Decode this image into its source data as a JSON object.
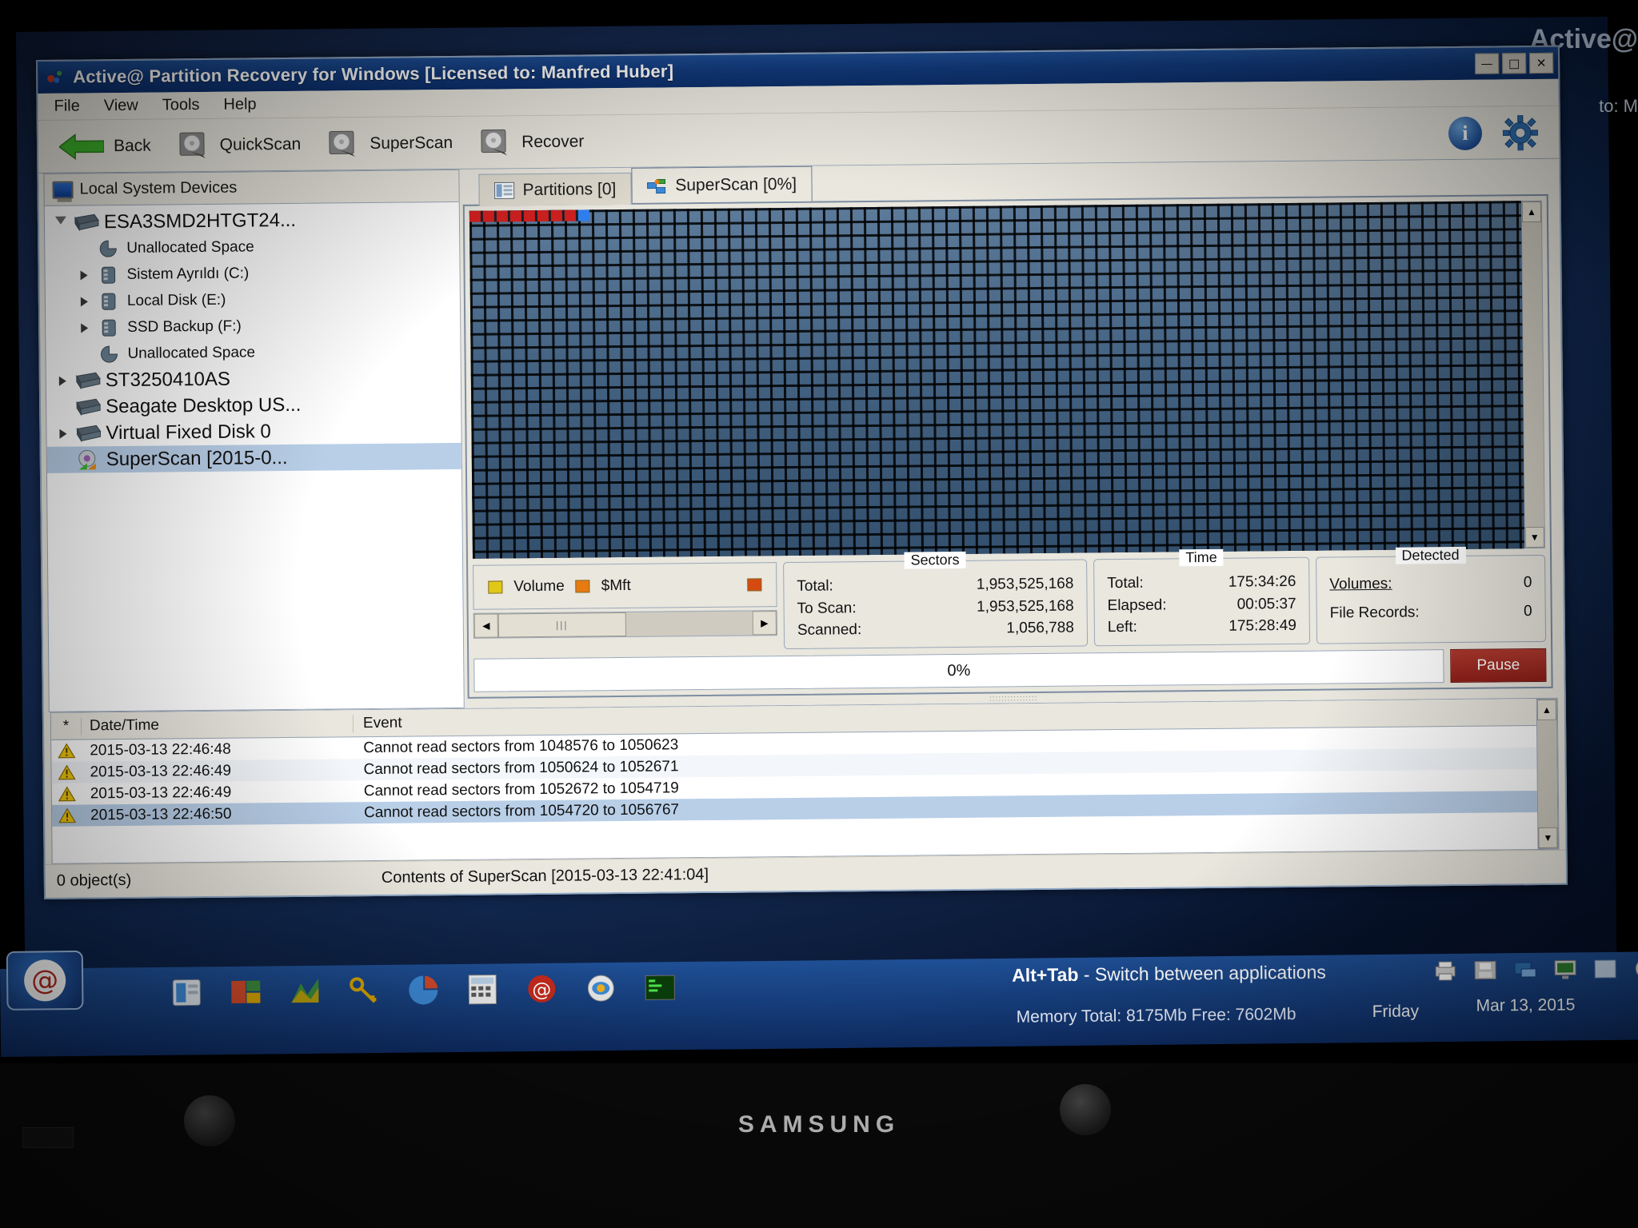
{
  "window": {
    "title": "Active@ Partition Recovery for Windows [Licensed to: Manfred Huber]",
    "minimize": "—",
    "maximize": "□",
    "close": "✕"
  },
  "menu": {
    "items": [
      "File",
      "View",
      "Tools",
      "Help"
    ]
  },
  "toolbar": {
    "back": "Back",
    "quickscan": "QuickScan",
    "superscan": "SuperScan",
    "recover": "Recover",
    "info": "i"
  },
  "sidebar": {
    "header": "Local System Devices",
    "items": [
      {
        "label": "ESA3SMD2HTGT24...",
        "level": 0,
        "icon": "disk-icon",
        "twisty": "open",
        "size": "big"
      },
      {
        "label": "Unallocated Space",
        "level": 1,
        "icon": "pie-icon",
        "twisty": "none",
        "size": "small"
      },
      {
        "label": "Sistem Ayrıldı (C:)",
        "level": 1,
        "icon": "volume-icon",
        "twisty": "closed",
        "size": "small"
      },
      {
        "label": "Local Disk (E:)",
        "level": 1,
        "icon": "volume-icon",
        "twisty": "closed",
        "size": "small"
      },
      {
        "label": "SSD Backup (F:)",
        "level": 1,
        "icon": "volume-icon",
        "twisty": "closed",
        "size": "small"
      },
      {
        "label": "Unallocated Space",
        "level": 1,
        "icon": "pie-icon",
        "twisty": "none",
        "size": "small"
      },
      {
        "label": "ST3250410AS",
        "level": 0,
        "icon": "disk-icon",
        "twisty": "closed",
        "size": "big"
      },
      {
        "label": "Seagate Desktop US...",
        "level": 0,
        "icon": "disk-icon",
        "twisty": "none",
        "size": "big"
      },
      {
        "label": "Virtual Fixed Disk 0",
        "level": 0,
        "icon": "disk-icon",
        "twisty": "closed",
        "size": "big"
      },
      {
        "label": "SuperScan [2015-0...",
        "level": 0,
        "icon": "superscan-icon",
        "twisty": "none",
        "size": "big",
        "selected": true
      }
    ]
  },
  "tabs": [
    {
      "label": "Partitions [0]",
      "icon": "partitions-icon",
      "active": false
    },
    {
      "label": "SuperScan [0%]",
      "icon": "superscan-tab-icon",
      "active": true
    }
  ],
  "legend": {
    "volume_label": "Volume",
    "volume_color": "#e0c818",
    "mft_label": "$Mft",
    "mft_color": "#e87a12",
    "third_color": "#d64a10"
  },
  "sectors": {
    "caption": "Sectors",
    "rows": [
      {
        "key": "Total:",
        "value": "1,953,525,168"
      },
      {
        "key": "To Scan:",
        "value": "1,953,525,168"
      },
      {
        "key": "Scanned:",
        "value": "1,056,788"
      }
    ]
  },
  "time": {
    "caption": "Time",
    "rows": [
      {
        "key": "Total:",
        "value": "175:34:26"
      },
      {
        "key": "Elapsed:",
        "value": "00:05:37"
      },
      {
        "key": "Left:",
        "value": "175:28:49"
      }
    ]
  },
  "detected": {
    "caption": "Detected",
    "rows": [
      {
        "key": "Volumes:",
        "value": "0",
        "underline": true
      },
      {
        "key": "File Records:",
        "value": "0",
        "underline": false
      }
    ]
  },
  "progress": {
    "percent_label": "0%",
    "percent_value": 0,
    "pause_label": "Pause"
  },
  "log": {
    "columns": [
      "*",
      "Date/Time",
      "Event"
    ],
    "rows": [
      {
        "datetime": "2015-03-13 22:46:48",
        "event": "Cannot read sectors from 1048576 to 1050623",
        "icon": "warning-icon",
        "selected": false
      },
      {
        "datetime": "2015-03-13 22:46:49",
        "event": "Cannot read sectors from 1050624 to 1052671",
        "icon": "warning-icon",
        "selected": false
      },
      {
        "datetime": "2015-03-13 22:46:49",
        "event": "Cannot read sectors from 1052672 to 1054719",
        "icon": "warning-icon",
        "selected": false
      },
      {
        "datetime": "2015-03-13 22:46:50",
        "event": "Cannot read sectors from 1054720 to 1056767",
        "icon": "warning-icon",
        "selected": true
      }
    ]
  },
  "statusbar": {
    "objects": "0 object(s)",
    "contents": "Contents of SuperScan [2015-03-13 22:41:04]"
  },
  "taskbar": {
    "hint_key": "Alt+Tab",
    "hint_text": "- Switch between applications",
    "memory": "Memory Total: 8175Mb Free: 7602Mb",
    "day": "Friday",
    "date": "Mar 13, 2015"
  },
  "background": {
    "ghost_title": "Active@",
    "ghost_sub": "to: M"
  },
  "bezel": {
    "brand": "SAMSUNG"
  }
}
